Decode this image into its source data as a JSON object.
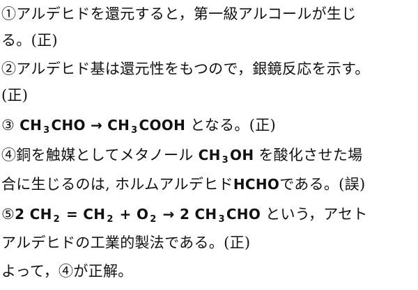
{
  "lines": {
    "l1": "①アルデヒドを還元すると，第一級アルコールが生じ",
    "l2": "る。(正)",
    "l3": "②アルデヒド基は還元性をもつので，銀鏡反応を示す。",
    "l4": "(正)",
    "l5": {
      "num": "③",
      "ch": "CH",
      "sub1": "3",
      "cho": "CHO →",
      "ch2": "CH",
      "sub2": "3",
      "cooh": "COOH",
      "tail": "となる。(正)"
    },
    "l6": {
      "head": "④銅を触媒としてメタノール",
      "ch": "CH",
      "sub": "3",
      "oh": "OH",
      "tail": "を酸化させた場"
    },
    "l7": {
      "head": "合に生じるのは, ホルムアルデヒド",
      "hcho": "HCHO",
      "tail": "である。(誤)"
    },
    "l8": {
      "num": "⑤",
      "f1": "2 CH",
      "s1": "2",
      "f2": "= CH",
      "s2": "2",
      "f3": "+ O",
      "s3": "2",
      "f4": "→ 2 CH",
      "s4": "3",
      "f5": "CHO",
      "tail": "という，アセト"
    },
    "l9": "アルデヒドの工業的製法である。(正)",
    "l10": "よって，④が正解。"
  }
}
